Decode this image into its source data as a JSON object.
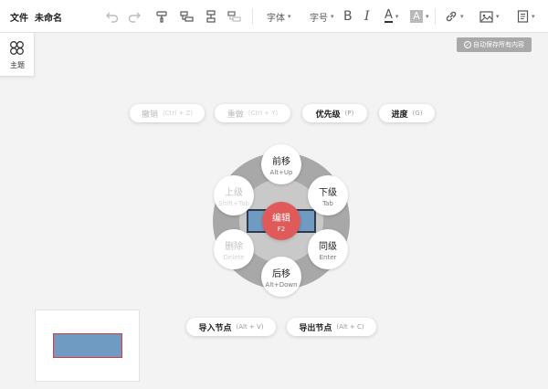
{
  "toolbar": {
    "file_label": "文件",
    "doc_title": "未命名",
    "font_family_label": "字体",
    "font_size_label": "字号",
    "bold_label": "B",
    "italic_label": "I",
    "font_color_label": "A",
    "bg_color_label": "A",
    "icons": [
      "undo-icon",
      "redo-icon",
      "format-painter-icon",
      "insert-child-icon",
      "insert-sibling-icon",
      "insert-parent-icon",
      "link-icon",
      "image-icon",
      "note-icon"
    ],
    "colors": {
      "font_color_bar": "#333333",
      "bg_color_swatch": "#b9b9b9"
    }
  },
  "theme_panel": {
    "label": "主题",
    "icon": "theme-icon"
  },
  "autosave": {
    "label": "自动保存所有内容"
  },
  "top_actions": [
    {
      "label": "撤销",
      "shortcut": "(Ctrl + Z)",
      "enabled": false
    },
    {
      "label": "重做",
      "shortcut": "(Ctrl + Y)",
      "enabled": false
    },
    {
      "label": "优先级",
      "shortcut": "(P)",
      "enabled": true
    },
    {
      "label": "进度",
      "shortcut": "(G)",
      "enabled": true
    }
  ],
  "radial_menu": {
    "center": {
      "label": "编辑",
      "shortcut": "F2"
    },
    "items": [
      {
        "key": "move-up",
        "label": "前移",
        "shortcut": "Alt+Up",
        "enabled": true
      },
      {
        "key": "child",
        "label": "下级",
        "shortcut": "Tab",
        "enabled": true
      },
      {
        "key": "sibling",
        "label": "同级",
        "shortcut": "Enter",
        "enabled": true
      },
      {
        "key": "move-down",
        "label": "后移",
        "shortcut": "Alt+Down",
        "enabled": true
      },
      {
        "key": "delete",
        "label": "删除",
        "shortcut": "Delete",
        "enabled": false
      },
      {
        "key": "parent",
        "label": "上级",
        "shortcut": "Shift+Tab",
        "enabled": false
      }
    ]
  },
  "bottom_actions": [
    {
      "label": "导入节点",
      "shortcut": "(Alt + V)"
    },
    {
      "label": "导出节点",
      "shortcut": "(Alt + C)"
    }
  ],
  "colors": {
    "accent": "#e05a5a",
    "node_fill": "#6f9bc3",
    "node_border": "#2f3a4a",
    "minimap_node_border": "#d73a3a"
  }
}
